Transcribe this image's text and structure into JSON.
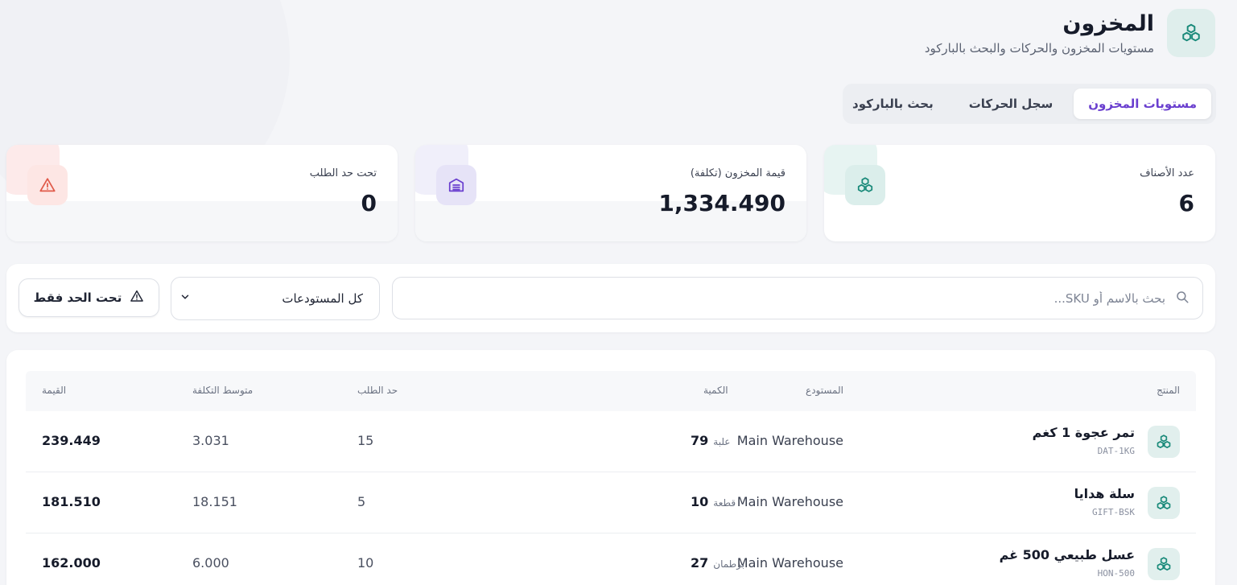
{
  "header": {
    "title": "المخزون",
    "subtitle": "مستويات المخزون والحركات والبحث بالباركود",
    "icon": "boxes-icon"
  },
  "tabs": [
    {
      "label": "مستويات المخزون",
      "active": true
    },
    {
      "label": "سجل الحركات",
      "active": false
    },
    {
      "label": "بحث بالباركود",
      "active": false
    }
  ],
  "stats": {
    "items": {
      "label": "عدد الأصناف",
      "value": "6",
      "icon": "boxes-icon",
      "color": "#1a8a7a"
    },
    "value": {
      "label": "قيمة المخزون (تكلفة)",
      "value": "1,334.490",
      "icon": "warehouse-icon",
      "color": "#6a3fcf"
    },
    "below": {
      "label": "تحت حد الطلب",
      "value": "0",
      "icon": "alert-triangle-icon",
      "color": "#e05a4a"
    }
  },
  "filters": {
    "search_placeholder": "بحث بالاسم أو SKU...",
    "warehouse_select": "كل المستودعات",
    "below_only_label": "تحت الحد فقط"
  },
  "table": {
    "columns": {
      "product": "المنتج",
      "warehouse": "المستودع",
      "quantity": "الكمية",
      "reorder": "حد الطلب",
      "avg_cost": "متوسط التكلفة",
      "value": "القيمة"
    },
    "rows": [
      {
        "name": "تمر عجوة 1 كغم",
        "sku": "DAT-1KG",
        "warehouse": "Main Warehouse",
        "qty": "79",
        "unit": "علبة",
        "reorder": "15",
        "avg_cost": "3.031",
        "value": "239.449"
      },
      {
        "name": "سلة هدايا",
        "sku": "GIFT-BSK",
        "warehouse": "Main Warehouse",
        "qty": "10",
        "unit": "قطعة",
        "reorder": "5",
        "avg_cost": "18.151",
        "value": "181.510"
      },
      {
        "name": "عسل طبيعي 500 غم",
        "sku": "HON-500",
        "warehouse": "Main Warehouse",
        "qty": "27",
        "unit": "برطمان",
        "reorder": "10",
        "avg_cost": "6.000",
        "value": "162.000"
      }
    ]
  },
  "colors": {
    "accent": "#6a3fcf",
    "teal": "#1a8a7a",
    "danger": "#e05a4a"
  }
}
